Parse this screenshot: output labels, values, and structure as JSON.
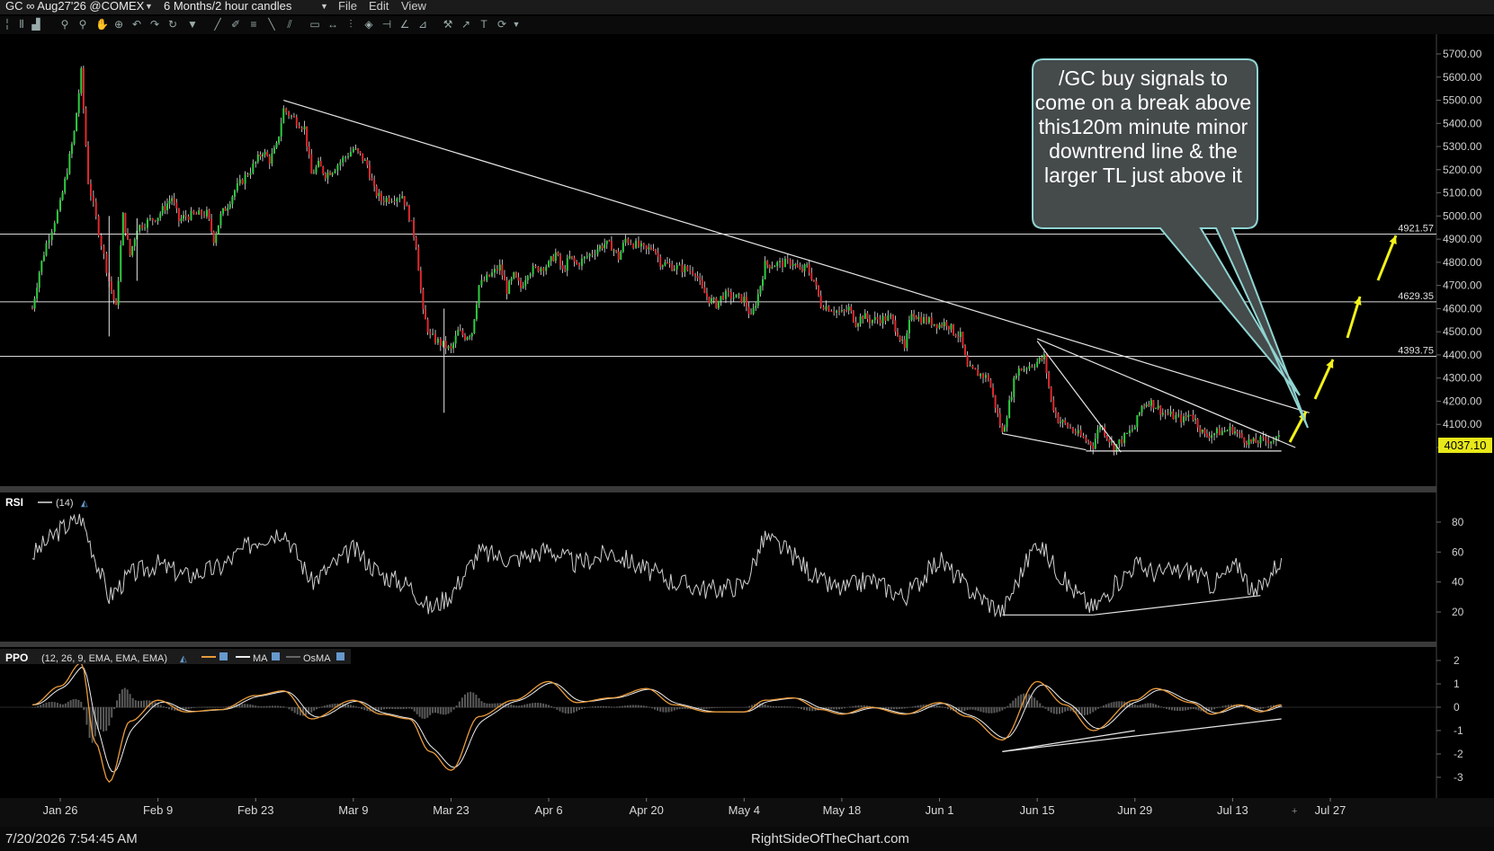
{
  "window": {
    "symbol_title": "GC ∞ Aug27'26 @COMEX",
    "timeframe": "6 Months/2 hour candles",
    "menu": [
      "File",
      "Edit",
      "View"
    ]
  },
  "main_chart": {
    "price_axis": [
      "5700.00",
      "5600.00",
      "5500.00",
      "5400.00",
      "5300.00",
      "5200.00",
      "5100.00",
      "5000.00",
      "4900.00",
      "4800.00",
      "4700.00",
      "4600.00",
      "4500.00",
      "4400.00",
      "4300.00",
      "4200.00",
      "4100.00",
      "4000.00"
    ],
    "level_labels": [
      "4921.57",
      "4629.35",
      "4393.75"
    ],
    "last_price": "4037.10",
    "callout": "/GC buy signals to come on a break above this120m minute minor downtrend line & the larger TL just above it"
  },
  "rsi_panel": {
    "name": "RSI",
    "params": "(14)",
    "axis": [
      "80",
      "60",
      "40",
      "20"
    ]
  },
  "ppo_panel": {
    "name": "PPO",
    "params": "(12, 26, 9, EMA, EMA, EMA)",
    "ma_label": "MA",
    "osma_label": "OsMA",
    "axis": [
      "2",
      "1",
      "0",
      "-1",
      "-2",
      "-3"
    ]
  },
  "x_axis": [
    "Jan 26",
    "Feb 9",
    "Feb 23",
    "Mar 9",
    "Mar 23",
    "Apr 6",
    "Apr 20",
    "May 4",
    "May 18",
    "Jun 1",
    "Jun 15",
    "Jun 29",
    "Jul 13",
    "Jul 27"
  ],
  "footer": {
    "timestamp": "7/20/2026 7:54:45 AM",
    "watermark": "RightSideOfTheChart.com"
  },
  "colors": {
    "up": "#2ecc40",
    "down": "#e0282e",
    "callout_bg": "#454a4a",
    "callout_border": "#8fd4d2",
    "arrow": "#f2f21a",
    "ppo_line": "#e89a3c",
    "last_price_bg": "#e8e81a"
  },
  "chart_data": [
    {
      "type": "candlestick",
      "title": "GC ∞ Aug27'26 @COMEX — 6 Months/2 hour candles",
      "ylim": [
        3920,
        5760
      ],
      "x_ticks": [
        "Jan 26",
        "Feb 9",
        "Feb 23",
        "Mar 9",
        "Mar 23",
        "Apr 6",
        "Apr 20",
        "May 4",
        "May 18",
        "Jun 1",
        "Jun 15",
        "Jun 29",
        "Jul 13",
        "Jul 27"
      ],
      "close_path": [
        [
          "Jan 22",
          4600
        ],
        [
          "Jan 23",
          4760
        ],
        [
          "Jan 24",
          4880
        ],
        [
          "Jan 26",
          5050
        ],
        [
          "Jan 27",
          5200
        ],
        [
          "Jan 28",
          5360
        ],
        [
          "Jan 29",
          5620
        ],
        [
          "Jan 30",
          5150
        ],
        [
          "Feb 2",
          4720
        ],
        [
          "Feb 3",
          4600
        ],
        [
          "Feb 4",
          5000
        ],
        [
          "Feb 5",
          4830
        ],
        [
          "Feb 6",
          4950
        ],
        [
          "Feb 9",
          5000
        ],
        [
          "Feb 10",
          5040
        ],
        [
          "Feb 11",
          5080
        ],
        [
          "Feb 12",
          4980
        ],
        [
          "Feb 13",
          5000
        ],
        [
          "Feb 16",
          5010
        ],
        [
          "Feb 17",
          4900
        ],
        [
          "Feb 18",
          5000
        ],
        [
          "Feb 19",
          5050
        ],
        [
          "Feb 20",
          5110
        ],
        [
          "Feb 23",
          5230
        ],
        [
          "Feb 24",
          5280
        ],
        [
          "Feb 25",
          5240
        ],
        [
          "Feb 26",
          5300
        ],
        [
          "Feb 27",
          5460
        ],
        [
          "Mar 2",
          5380
        ],
        [
          "Mar 3",
          5180
        ],
        [
          "Mar 4",
          5220
        ],
        [
          "Mar 5",
          5180
        ],
        [
          "Mar 6",
          5200
        ],
        [
          "Mar 9",
          5290
        ],
        [
          "Mar 10",
          5260
        ],
        [
          "Mar 11",
          5220
        ],
        [
          "Mar 12",
          5110
        ],
        [
          "Mar 13",
          5070
        ],
        [
          "Mar 16",
          5090
        ],
        [
          "Mar 17",
          5000
        ],
        [
          "Mar 18",
          4880
        ],
        [
          "Mar 19",
          4580
        ],
        [
          "Mar 20",
          4480
        ],
        [
          "Mar 23",
          4420
        ],
        [
          "Mar 24",
          4500
        ],
        [
          "Mar 25",
          4480
        ],
        [
          "Mar 26",
          4500
        ],
        [
          "Mar 27",
          4700
        ],
        [
          "Mar 30",
          4780
        ],
        [
          "Mar 31",
          4680
        ],
        [
          "Apr 1",
          4740
        ],
        [
          "Apr 2",
          4690
        ],
        [
          "Apr 3",
          4760
        ],
        [
          "Apr 6",
          4790
        ],
        [
          "Apr 7",
          4840
        ],
        [
          "Apr 8",
          4760
        ],
        [
          "Apr 9",
          4820
        ],
        [
          "Apr 10",
          4790
        ],
        [
          "Apr 13",
          4860
        ],
        [
          "Apr 14",
          4880
        ],
        [
          "Apr 15",
          4870
        ],
        [
          "Apr 16",
          4820
        ],
        [
          "Apr 17",
          4900
        ],
        [
          "Apr 20",
          4850
        ],
        [
          "Apr 21",
          4870
        ],
        [
          "Apr 22",
          4800
        ],
        [
          "Apr 23",
          4790
        ],
        [
          "Apr 24",
          4780
        ],
        [
          "Apr 27",
          4760
        ],
        [
          "Apr 28",
          4680
        ],
        [
          "Apr 29",
          4640
        ],
        [
          "Apr 30",
          4620
        ],
        [
          "May 1",
          4660
        ],
        [
          "May 4",
          4640
        ],
        [
          "May 5",
          4560
        ],
        [
          "May 6",
          4660
        ],
        [
          "May 7",
          4790
        ],
        [
          "May 8",
          4790
        ],
        [
          "May 11",
          4800
        ],
        [
          "May 12",
          4760
        ],
        [
          "May 13",
          4780
        ],
        [
          "May 14",
          4720
        ],
        [
          "May 15",
          4620
        ],
        [
          "May 18",
          4580
        ],
        [
          "May 19",
          4600
        ],
        [
          "May 20",
          4540
        ],
        [
          "May 21",
          4570
        ],
        [
          "May 22",
          4550
        ],
        [
          "May 25",
          4560
        ],
        [
          "May 26",
          4500
        ],
        [
          "May 27",
          4420
        ],
        [
          "May 28",
          4590
        ],
        [
          "May 29",
          4560
        ],
        [
          "Jun 1",
          4530
        ],
        [
          "Jun 2",
          4540
        ],
        [
          "Jun 3",
          4500
        ],
        [
          "Jun 4",
          4480
        ],
        [
          "Jun 5",
          4340
        ],
        [
          "Jun 8",
          4300
        ],
        [
          "Jun 9",
          4180
        ],
        [
          "Jun 10",
          4060
        ],
        [
          "Jun 11",
          4190
        ],
        [
          "Jun 12",
          4330
        ],
        [
          "Jun 15",
          4370
        ],
        [
          "Jun 16",
          4390
        ],
        [
          "Jun 17",
          4200
        ],
        [
          "Jun 18",
          4120
        ],
        [
          "Jun 19",
          4100
        ],
        [
          "Jun 22",
          4030
        ],
        [
          "Jun 23",
          4010
        ],
        [
          "Jun 24",
          4100
        ],
        [
          "Jun 25",
          4050
        ],
        [
          "Jun 26",
          4000
        ],
        [
          "Jun 29",
          4090
        ],
        [
          "Jun 30",
          4180
        ],
        [
          "Jul 1",
          4200
        ],
        [
          "Jul 2",
          4180
        ],
        [
          "Jul 3",
          4150
        ],
        [
          "Jul 6",
          4120
        ],
        [
          "Jul 7",
          4150
        ],
        [
          "Jul 8",
          4100
        ],
        [
          "Jul 9",
          4050
        ],
        [
          "Jul 10",
          4060
        ],
        [
          "Jul 13",
          4080
        ],
        [
          "Jul 14",
          4050
        ],
        [
          "Jul 15",
          4030
        ],
        [
          "Jul 16",
          4020
        ],
        [
          "Jul 17",
          4030
        ],
        [
          "Jul 20",
          4037.1
        ]
      ],
      "horizontal_levels": [
        4921.57,
        4629.35,
        4393.75
      ],
      "trendlines": [
        {
          "name": "larger downtrend line",
          "from": [
            "Feb 27",
            5500
          ],
          "to": [
            "Jul 24",
            4150
          ]
        },
        {
          "name": "minor downtrend line",
          "from": [
            "Jun 15",
            4470
          ],
          "to": [
            "Jul 22",
            4000
          ]
        },
        {
          "name": "support",
          "from": [
            "Jun 22",
            3985
          ],
          "to": [
            "Jul 20",
            3985
          ]
        }
      ]
    },
    {
      "type": "line",
      "title": "RSI (14)",
      "ylim": [
        0,
        100
      ],
      "y_ticks": [
        80,
        60,
        40,
        20
      ],
      "points": [
        [
          "Jan 22",
          58
        ],
        [
          "Jan 26",
          75
        ],
        [
          "Jan 29",
          83
        ],
        [
          "Feb 2",
          30
        ],
        [
          "Feb 5",
          45
        ],
        [
          "Feb 9",
          52
        ],
        [
          "Feb 13",
          44
        ],
        [
          "Feb 18",
          50
        ],
        [
          "Feb 23",
          68
        ],
        [
          "Feb 27",
          75
        ],
        [
          "Mar 3",
          40
        ],
        [
          "Mar 9",
          62
        ],
        [
          "Mar 13",
          45
        ],
        [
          "Mar 17",
          38
        ],
        [
          "Mar 20",
          22
        ],
        [
          "Mar 23",
          32
        ],
        [
          "Mar 27",
          60
        ],
        [
          "Apr 1",
          55
        ],
        [
          "Apr 6",
          62
        ],
        [
          "Apr 10",
          52
        ],
        [
          "Apr 15",
          60
        ],
        [
          "Apr 20",
          48
        ],
        [
          "Apr 24",
          40
        ],
        [
          "Apr 29",
          35
        ],
        [
          "May 4",
          38
        ],
        [
          "May 7",
          70
        ],
        [
          "May 11",
          58
        ],
        [
          "May 15",
          40
        ],
        [
          "May 18",
          35
        ],
        [
          "May 22",
          42
        ],
        [
          "May 27",
          30
        ],
        [
          "Jun 1",
          55
        ],
        [
          "Jun 5",
          36
        ],
        [
          "Jun 10",
          20
        ],
        [
          "Jun 15",
          68
        ],
        [
          "Jun 19",
          40
        ],
        [
          "Jun 23",
          22
        ],
        [
          "Jun 29",
          52
        ],
        [
          "Jul 2",
          46
        ],
        [
          "Jul 7",
          48
        ],
        [
          "Jul 10",
          38
        ],
        [
          "Jul 14",
          52
        ],
        [
          "Jul 16",
          30
        ],
        [
          "Jul 20",
          56
        ]
      ],
      "trendlines": [
        {
          "from": [
            "Jun 10",
            18
          ],
          "to": [
            "Jun 23",
            18
          ]
        },
        {
          "from": [
            "Jun 23",
            18
          ],
          "to": [
            "Jul 17",
            31
          ]
        }
      ]
    },
    {
      "type": "line",
      "title": "PPO (12, 26, 9, EMA, EMA, EMA)",
      "ylim": [
        -3.5,
        2.3
      ],
      "y_ticks": [
        2,
        1,
        0,
        -1,
        -2,
        -3
      ],
      "series": [
        {
          "name": "PPO",
          "points": [
            [
              "Jan 22",
              0.1
            ],
            [
              "Jan 26",
              0.9
            ],
            [
              "Jan 29",
              1.9
            ],
            [
              "Jan 31",
              -1.5
            ],
            [
              "Feb 2",
              -3.2
            ],
            [
              "Feb 5",
              -0.6
            ],
            [
              "Feb 9",
              0.3
            ],
            [
              "Feb 13",
              -0.2
            ],
            [
              "Feb 18",
              -0.1
            ],
            [
              "Feb 23",
              0.5
            ],
            [
              "Feb 27",
              0.7
            ],
            [
              "Mar 3",
              -0.5
            ],
            [
              "Mar 9",
              0.3
            ],
            [
              "Mar 13",
              -0.3
            ],
            [
              "Mar 17",
              -0.5
            ],
            [
              "Mar 20",
              -1.9
            ],
            [
              "Mar 23",
              -2.7
            ],
            [
              "Mar 27",
              -0.4
            ],
            [
              "Apr 1",
              0.3
            ],
            [
              "Apr 6",
              1.1
            ],
            [
              "Apr 10",
              0.2
            ],
            [
              "Apr 15",
              0.4
            ],
            [
              "Apr 20",
              0.8
            ],
            [
              "Apr 24",
              0.1
            ],
            [
              "Apr 29",
              -0.2
            ],
            [
              "May 4",
              -0.2
            ],
            [
              "May 7",
              0.3
            ],
            [
              "May 11",
              0.4
            ],
            [
              "May 15",
              -0.1
            ],
            [
              "May 18",
              -0.3
            ],
            [
              "May 22",
              0.0
            ],
            [
              "May 27",
              -0.3
            ],
            [
              "Jun 1",
              0.2
            ],
            [
              "Jun 5",
              -0.4
            ],
            [
              "Jun 10",
              -1.4
            ],
            [
              "Jun 15",
              1.1
            ],
            [
              "Jun 19",
              0.1
            ],
            [
              "Jun 23",
              -1.0
            ],
            [
              "Jun 29",
              0.3
            ],
            [
              "Jul 2",
              0.8
            ],
            [
              "Jul 7",
              0.2
            ],
            [
              "Jul 10",
              -0.3
            ],
            [
              "Jul 14",
              0.1
            ],
            [
              "Jul 17",
              -0.2
            ],
            [
              "Jul 20",
              0.1
            ]
          ]
        }
      ],
      "trendlines": [
        {
          "from": [
            "Jun 10",
            -1.9
          ],
          "to": [
            "Jun 29",
            -1.0
          ]
        },
        {
          "from": [
            "Jun 10",
            -1.9
          ],
          "to": [
            "Jul 20",
            -0.5
          ]
        }
      ]
    }
  ]
}
